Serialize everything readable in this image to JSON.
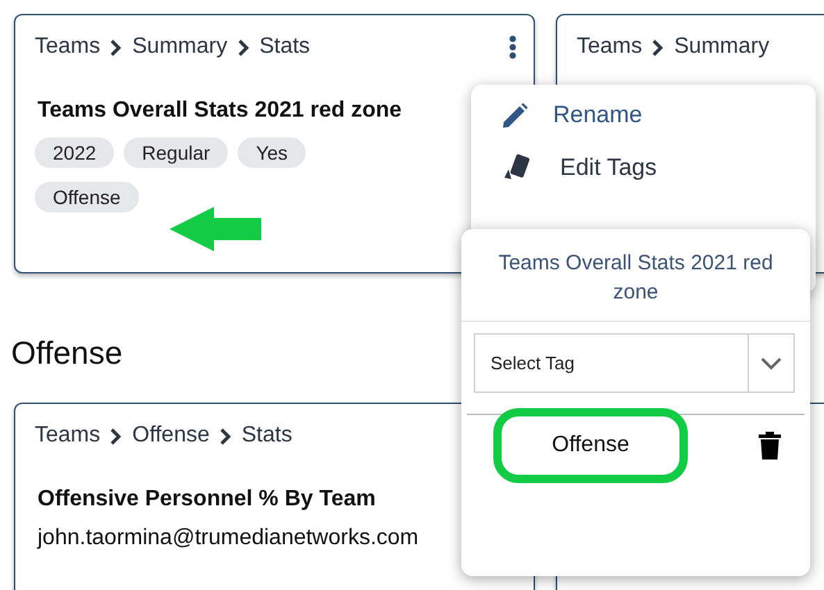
{
  "sections": [
    {
      "cards": [
        {
          "breadcrumb": [
            "Teams",
            "Summary",
            "Stats"
          ],
          "has_menu": true,
          "title": "Teams Overall Stats 2021 red zone",
          "tag_rows": [
            [
              "2022",
              "Regular",
              "Yes"
            ],
            [
              "Offense"
            ]
          ]
        },
        {
          "breadcrumb": [
            "Teams",
            "Summary"
          ]
        }
      ]
    },
    {
      "heading": "Offense",
      "cards": [
        {
          "breadcrumb": [
            "Teams",
            "Offense",
            "Stats"
          ],
          "title": "Offensive Personnel % By Team",
          "owner": "john.taormina@trumedianetworks.com"
        }
      ],
      "covered_card": true
    }
  ],
  "context_menu": {
    "items": [
      {
        "kind": "rename",
        "label": "Rename"
      },
      {
        "kind": "tags",
        "label": "Edit Tags"
      }
    ]
  },
  "tag_editor": {
    "title": "Teams Overall Stats 2021 red zone",
    "select": {
      "placeholder": "Select Tag"
    },
    "tags": [
      {
        "label": "Offense",
        "highlighted": true
      }
    ]
  },
  "annotation_arrow": true
}
